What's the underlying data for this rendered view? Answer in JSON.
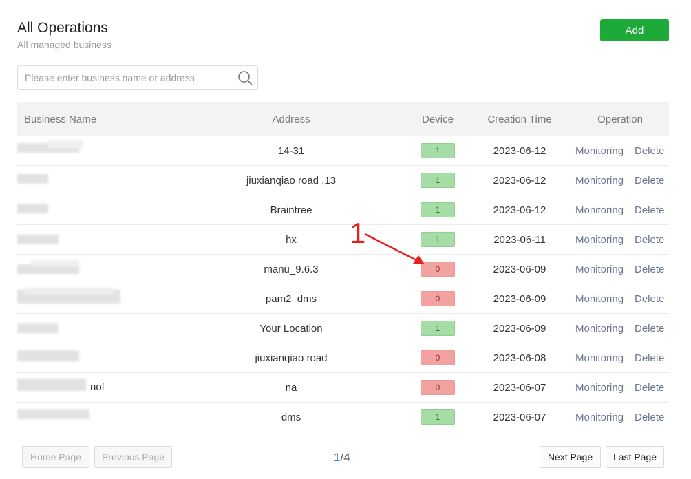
{
  "header": {
    "title": "All Operations",
    "subtitle": "All managed business",
    "add_label": "Add"
  },
  "search": {
    "placeholder": "Please enter business name or address",
    "value": ""
  },
  "table": {
    "columns": [
      "Business Name",
      "Address",
      "Device",
      "Creation Time",
      "Operation"
    ],
    "rows": [
      {
        "name": "",
        "address": "14-31",
        "device": "1",
        "status": "on",
        "created": "2023-06-12",
        "monitor": "Monitoring",
        "delete": "Delete"
      },
      {
        "name": "",
        "address": "jiuxianqiao road ,13",
        "device": "1",
        "status": "on",
        "created": "2023-06-12",
        "monitor": "Monitoring",
        "delete": "Delete"
      },
      {
        "name": "",
        "address": "Braintree",
        "device": "1",
        "status": "on",
        "created": "2023-06-12",
        "monitor": "Monitoring",
        "delete": "Delete"
      },
      {
        "name": "",
        "address": "hx",
        "device": "1",
        "status": "on",
        "created": "2023-06-11",
        "monitor": "Monitoring",
        "delete": "Delete"
      },
      {
        "name": "",
        "address": "manu_9.6.3",
        "device": "0",
        "status": "off",
        "created": "2023-06-09",
        "monitor": "Monitoring",
        "delete": "Delete"
      },
      {
        "name": "",
        "address": "pam2_dms",
        "device": "0",
        "status": "off",
        "created": "2023-06-09",
        "monitor": "Monitoring",
        "delete": "Delete"
      },
      {
        "name": "",
        "address": "Your Location",
        "device": "1",
        "status": "on",
        "created": "2023-06-09",
        "monitor": "Monitoring",
        "delete": "Delete"
      },
      {
        "name": "",
        "address": "jiuxianqiao road",
        "device": "0",
        "status": "off",
        "created": "2023-06-08",
        "monitor": "Monitoring",
        "delete": "Delete"
      },
      {
        "name": "nof",
        "address": "na",
        "device": "0",
        "status": "off",
        "created": "2023-06-07",
        "monitor": "Monitoring",
        "delete": "Delete"
      },
      {
        "name": "",
        "address": "dms",
        "device": "1",
        "status": "on",
        "created": "2023-06-07",
        "monitor": "Monitoring",
        "delete": "Delete"
      }
    ]
  },
  "pager": {
    "home": "Home Page",
    "previous": "Previous Page",
    "current": "1",
    "total": "/4",
    "next": "Next Page",
    "last": "Last Page"
  },
  "annotation": {
    "label": "1",
    "color": "#e8201c"
  },
  "colors": {
    "primary": "#1eaa39",
    "device_on": "#a6dca5",
    "device_off": "#f2a3a1",
    "link": "#6c7690"
  },
  "icons": {
    "search": "search-icon",
    "arrow": "annotation-arrow-icon"
  }
}
